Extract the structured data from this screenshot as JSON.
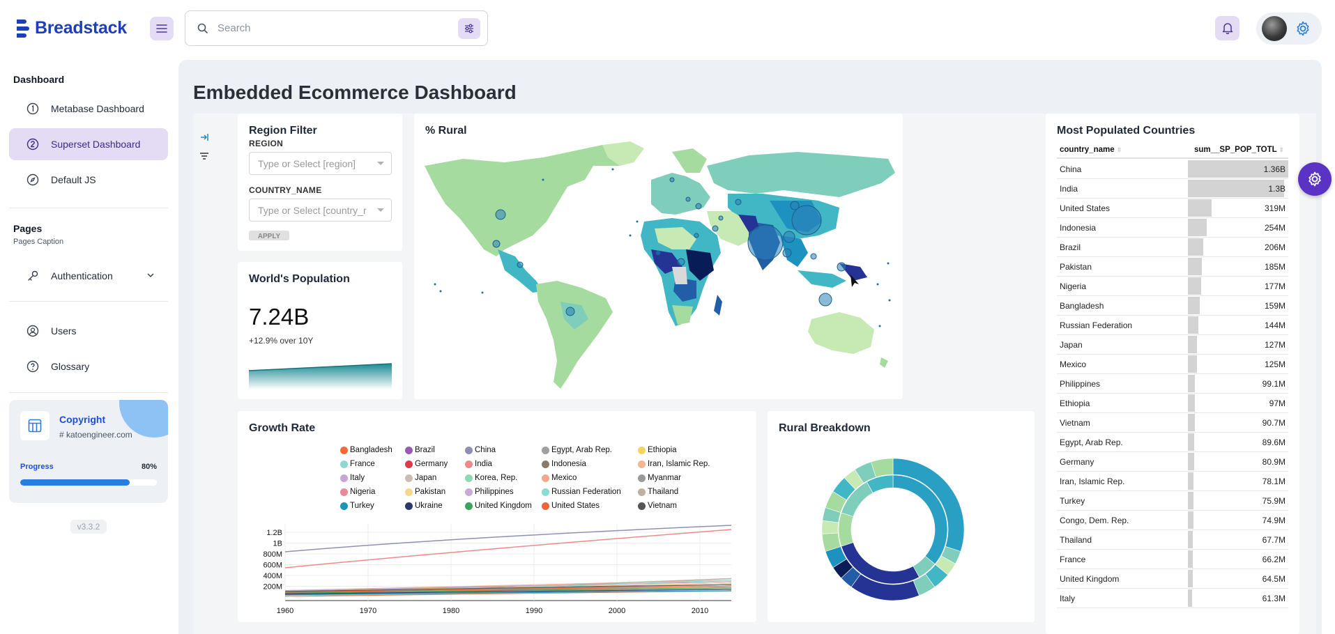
{
  "app": {
    "name": "Breadstack"
  },
  "search": {
    "placeholder": "Search"
  },
  "sidebar": {
    "dashboard_heading": "Dashboard",
    "items": [
      {
        "label": "Metabase Dashboard",
        "icon": "number-one-circle-icon"
      },
      {
        "label": "Superset Dashboard",
        "icon": "number-two-circle-icon",
        "active": true
      },
      {
        "label": "Default JS",
        "icon": "compass-icon"
      }
    ],
    "pages_heading": "Pages",
    "pages_caption": "Pages Caption",
    "auth_item": {
      "label": "Authentication",
      "icon": "key-icon"
    },
    "more_items": [
      {
        "label": "Users",
        "icon": "users-icon"
      },
      {
        "label": "Glossary",
        "icon": "help-circle-icon"
      }
    ],
    "copyright": {
      "title": "Copyright",
      "subtitle": "# katoengineer.com",
      "progress_label": "Progress",
      "progress_text": "80%",
      "progress": 0.8
    },
    "version": "v3.3.2"
  },
  "page": {
    "title": "Embedded Ecommerce Dashboard"
  },
  "region_filter": {
    "title": "Region Filter",
    "region_label": "REGION",
    "region_placeholder": "Type or Select [region]",
    "country_label": "COUNTRY_NAME",
    "country_placeholder": "Type or Select [country_r",
    "apply_label": "APPLY"
  },
  "rural_map": {
    "title": "% Rural"
  },
  "world_population": {
    "title": "World's Population",
    "value": "7.24B",
    "subtitle": "+12.9% over 10Y"
  },
  "growth_rate": {
    "title": "Growth Rate",
    "legend": [
      {
        "name": "Bangladesh",
        "color": "#f26b3a"
      },
      {
        "name": "Brazil",
        "color": "#9b59b6"
      },
      {
        "name": "China",
        "color": "#8f8fb5"
      },
      {
        "name": "Egypt, Arab Rep.",
        "color": "#a0a0a0"
      },
      {
        "name": "Ethiopia",
        "color": "#f6d55c"
      },
      {
        "name": "France",
        "color": "#8fd8d2"
      },
      {
        "name": "Germany",
        "color": "#e0394a"
      },
      {
        "name": "India",
        "color": "#ef8a8a"
      },
      {
        "name": "Indonesia",
        "color": "#8a7a6a"
      },
      {
        "name": "Iran, Islamic Rep.",
        "color": "#f6b694"
      },
      {
        "name": "Italy",
        "color": "#c7a6d8"
      },
      {
        "name": "Japan",
        "color": "#c8bdb0"
      },
      {
        "name": "Korea, Rep.",
        "color": "#8ed9b5"
      },
      {
        "name": "Mexico",
        "color": "#f7a98a"
      },
      {
        "name": "Myanmar",
        "color": "#9a9a9a"
      },
      {
        "name": "Nigeria",
        "color": "#e88a9a"
      },
      {
        "name": "Pakistan",
        "color": "#f7d78a"
      },
      {
        "name": "Philippines",
        "color": "#c9a8dc"
      },
      {
        "name": "Russian Federation",
        "color": "#8adcd6"
      },
      {
        "name": "Thailand",
        "color": "#c0b0a0"
      },
      {
        "name": "Turkey",
        "color": "#1f94b4"
      },
      {
        "name": "Ukraine",
        "color": "#2b3a6b"
      },
      {
        "name": "United Kingdom",
        "color": "#3aa55a"
      },
      {
        "name": "United States",
        "color": "#f0643a"
      },
      {
        "name": "Vietnam",
        "color": "#555555"
      }
    ],
    "y_ticks": [
      "1.2B",
      "1B",
      "800M",
      "600M",
      "400M",
      "200M"
    ],
    "x_ticks": [
      "1960",
      "1970",
      "1980",
      "1990",
      "2000",
      "2010"
    ]
  },
  "rural_breakdown": {
    "title": "Rural Breakdown"
  },
  "populated": {
    "title": "Most Populated Countries",
    "col1": "country_name",
    "col2": "sum__SP_POP_TOTL",
    "rows": [
      {
        "name": "China",
        "value": "1.36B",
        "num": 1.36
      },
      {
        "name": "India",
        "value": "1.3B",
        "num": 1.3
      },
      {
        "name": "United States",
        "value": "319M",
        "num": 0.319
      },
      {
        "name": "Indonesia",
        "value": "254M",
        "num": 0.254
      },
      {
        "name": "Brazil",
        "value": "206M",
        "num": 0.206
      },
      {
        "name": "Pakistan",
        "value": "185M",
        "num": 0.185
      },
      {
        "name": "Nigeria",
        "value": "177M",
        "num": 0.177
      },
      {
        "name": "Bangladesh",
        "value": "159M",
        "num": 0.159
      },
      {
        "name": "Russian Federation",
        "value": "144M",
        "num": 0.144
      },
      {
        "name": "Japan",
        "value": "127M",
        "num": 0.127
      },
      {
        "name": "Mexico",
        "value": "125M",
        "num": 0.125
      },
      {
        "name": "Philippines",
        "value": "99.1M",
        "num": 0.0991
      },
      {
        "name": "Ethiopia",
        "value": "97M",
        "num": 0.097
      },
      {
        "name": "Vietnam",
        "value": "90.7M",
        "num": 0.0907
      },
      {
        "name": "Egypt, Arab Rep.",
        "value": "89.6M",
        "num": 0.0896
      },
      {
        "name": "Germany",
        "value": "80.9M",
        "num": 0.0809
      },
      {
        "name": "Iran, Islamic Rep.",
        "value": "78.1M",
        "num": 0.0781
      },
      {
        "name": "Turkey",
        "value": "75.9M",
        "num": 0.0759
      },
      {
        "name": "Congo, Dem. Rep.",
        "value": "74.9M",
        "num": 0.0749
      },
      {
        "name": "Thailand",
        "value": "67.7M",
        "num": 0.0677
      },
      {
        "name": "France",
        "value": "66.2M",
        "num": 0.0662
      },
      {
        "name": "United Kingdom",
        "value": "64.5M",
        "num": 0.0645
      },
      {
        "name": "Italy",
        "value": "61.3M",
        "num": 0.0613
      }
    ]
  }
}
